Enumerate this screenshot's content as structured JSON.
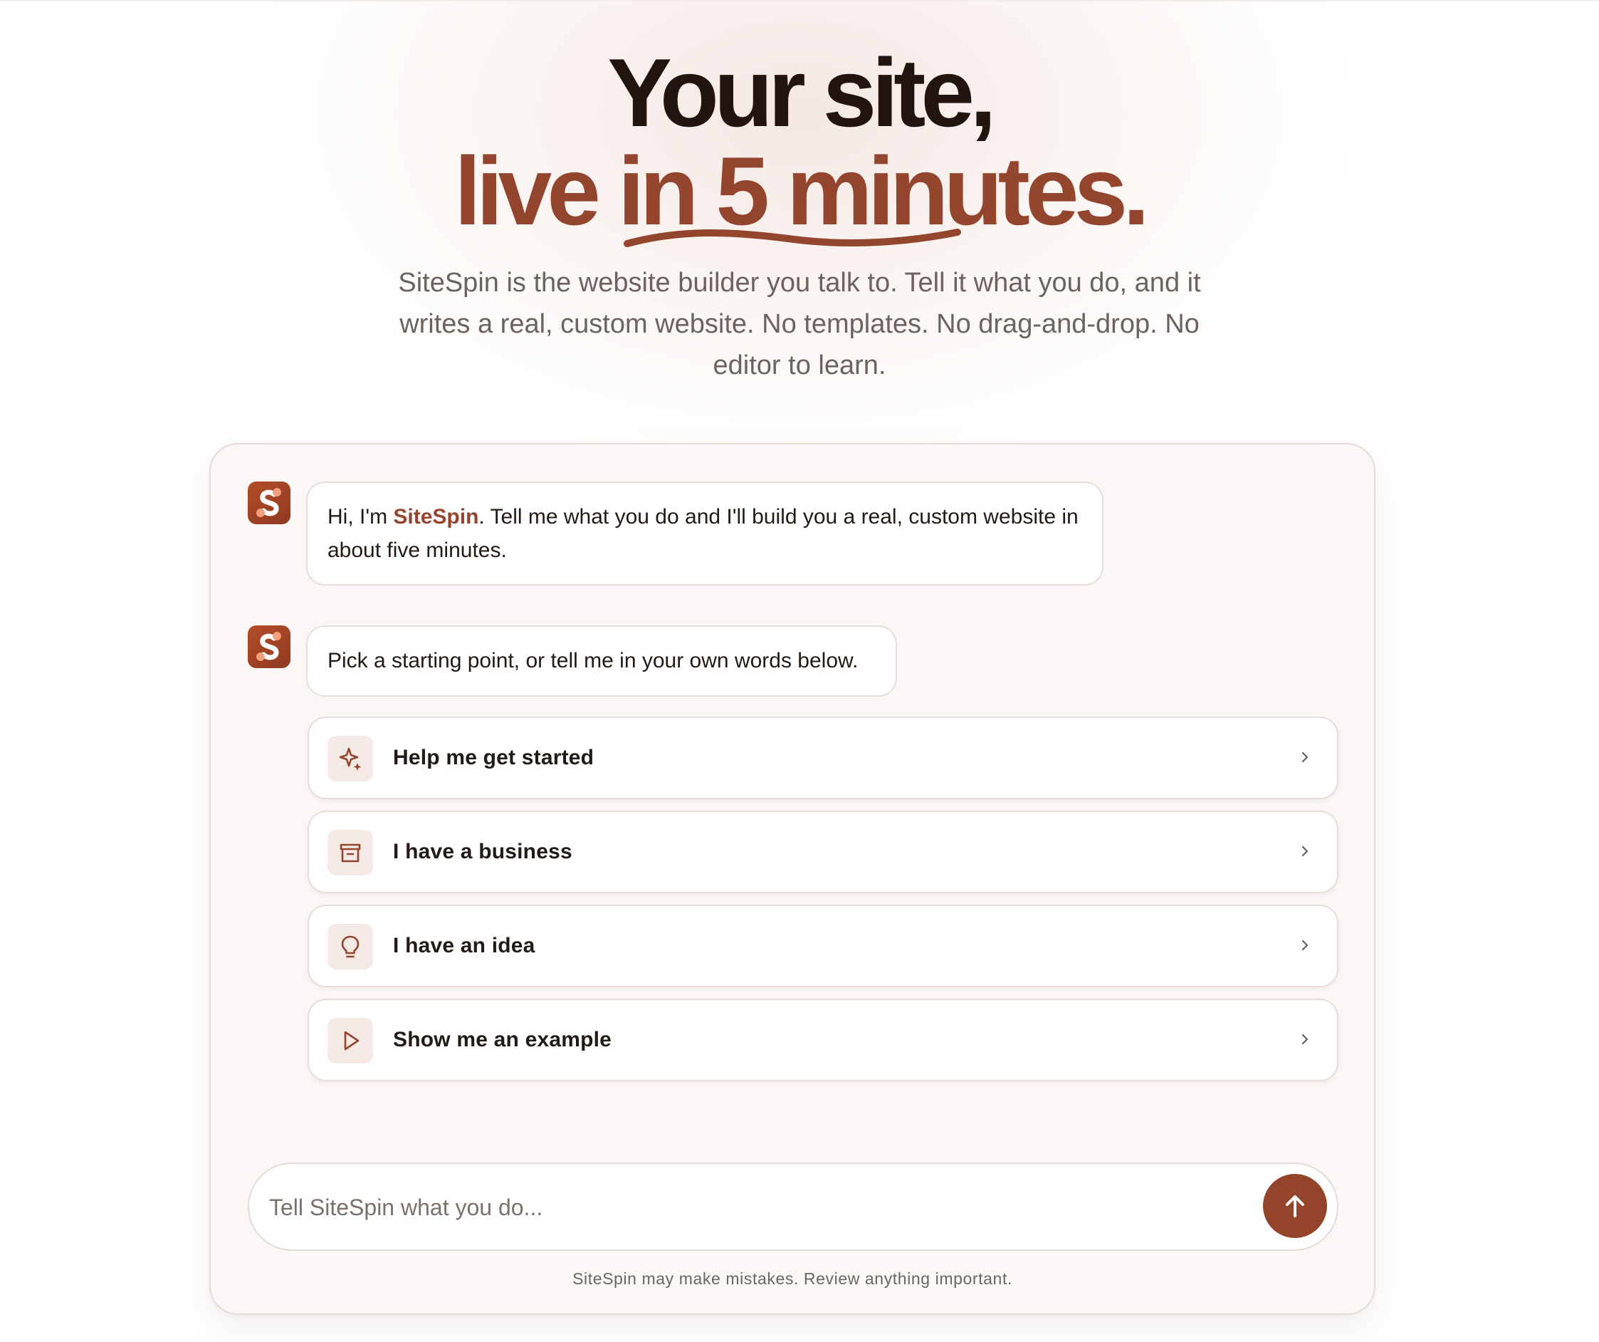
{
  "hero": {
    "title_line1": "Your site,",
    "title_line2": "live in 5 minutes.",
    "subtitle": "SiteSpin is the website builder you talk to. Tell it what you do, and it writes a real, custom website. No templates. No drag-and-drop. No editor to learn."
  },
  "chat": {
    "messages": [
      {
        "avatar_icon": "sitespin-logo-icon",
        "text_before": "Hi, I'm ",
        "brand": "SiteSpin",
        "text_after": ". Tell me what you do and I'll build you a real, custom website in about five minutes."
      },
      {
        "avatar_icon": "sitespin-logo-icon",
        "text": "Pick a starting point, or tell me in your own words below."
      }
    ],
    "options": [
      {
        "label": "Help me get started",
        "icon": "sparkle-icon"
      },
      {
        "label": "I have a business",
        "icon": "storefront-icon"
      },
      {
        "label": "I have an idea",
        "icon": "lightbulb-icon"
      },
      {
        "label": "Show me an example",
        "icon": "play-icon"
      }
    ],
    "composer": {
      "placeholder": "Tell SiteSpin what you do...",
      "send_icon": "arrow-up-icon"
    },
    "disclaimer": "SiteSpin may make mistakes. Review anything important."
  },
  "colors": {
    "accent": "#93462d",
    "title_dark": "#22150f",
    "card_bg": "#faf7f6",
    "icon_tile_bg": "#f4e9e5"
  }
}
